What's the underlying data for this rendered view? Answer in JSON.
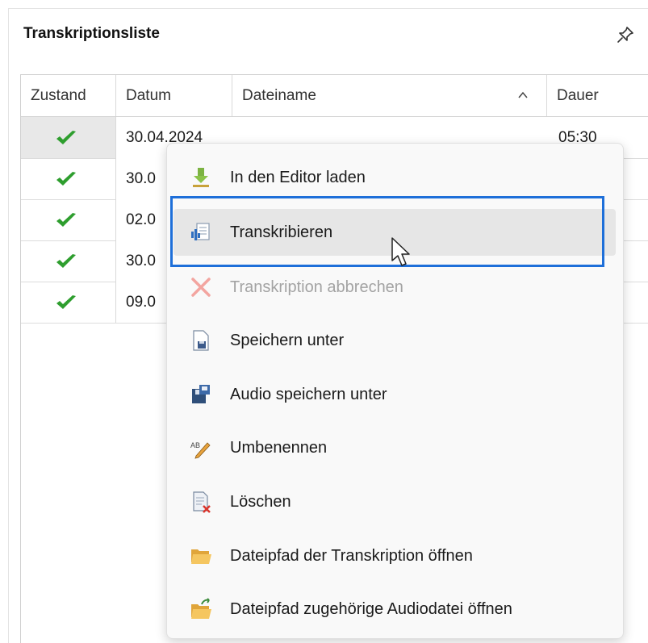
{
  "panel": {
    "title": "Transkriptionsliste",
    "pin_icon": "pin-icon"
  },
  "grid": {
    "columns": [
      "Zustand",
      "Datum",
      "Dateiname",
      "Dauer"
    ],
    "sort_icon": "chevron-up-icon",
    "rows": [
      {
        "state_icon": "green-check-icon",
        "date": "30.04.2024",
        "file": "",
        "duration": "05:30"
      },
      {
        "state_icon": "green-check-icon",
        "date": "30.0",
        "file": "",
        "duration": ""
      },
      {
        "state_icon": "green-check-icon",
        "date": "02.0",
        "file": "",
        "duration": ""
      },
      {
        "state_icon": "green-check-icon",
        "date": "30.0",
        "file": "",
        "duration": ""
      },
      {
        "state_icon": "green-check-icon",
        "date": "09.0",
        "file": "",
        "duration": ""
      }
    ]
  },
  "menu": {
    "items": [
      {
        "label": "In den Editor laden",
        "icon": "download-icon",
        "enabled": true
      },
      {
        "label": "Transkribieren",
        "icon": "transcribe-icon",
        "enabled": true,
        "highlighted": true
      },
      {
        "label": "Transkription abbrechen",
        "icon": "cancel-x-icon",
        "enabled": false
      },
      {
        "label": "Speichern unter",
        "icon": "save-document-icon",
        "enabled": true
      },
      {
        "label": "Audio speichern unter",
        "icon": "save-audio-icon",
        "enabled": true
      },
      {
        "label": "Umbenennen",
        "icon": "rename-icon",
        "enabled": true
      },
      {
        "label": "Löschen",
        "icon": "delete-document-icon",
        "enabled": true
      },
      {
        "label": "Dateipfad der Transkription öffnen",
        "icon": "folder-open-icon",
        "enabled": true
      },
      {
        "label": "Dateipfad zugehörige Audiodatei öffnen",
        "icon": "folder-arrow-icon",
        "enabled": true
      }
    ]
  },
  "colors": {
    "accent": "#1e6fd9",
    "check": "#2e9e2e",
    "hover": "#e6e6e6"
  }
}
